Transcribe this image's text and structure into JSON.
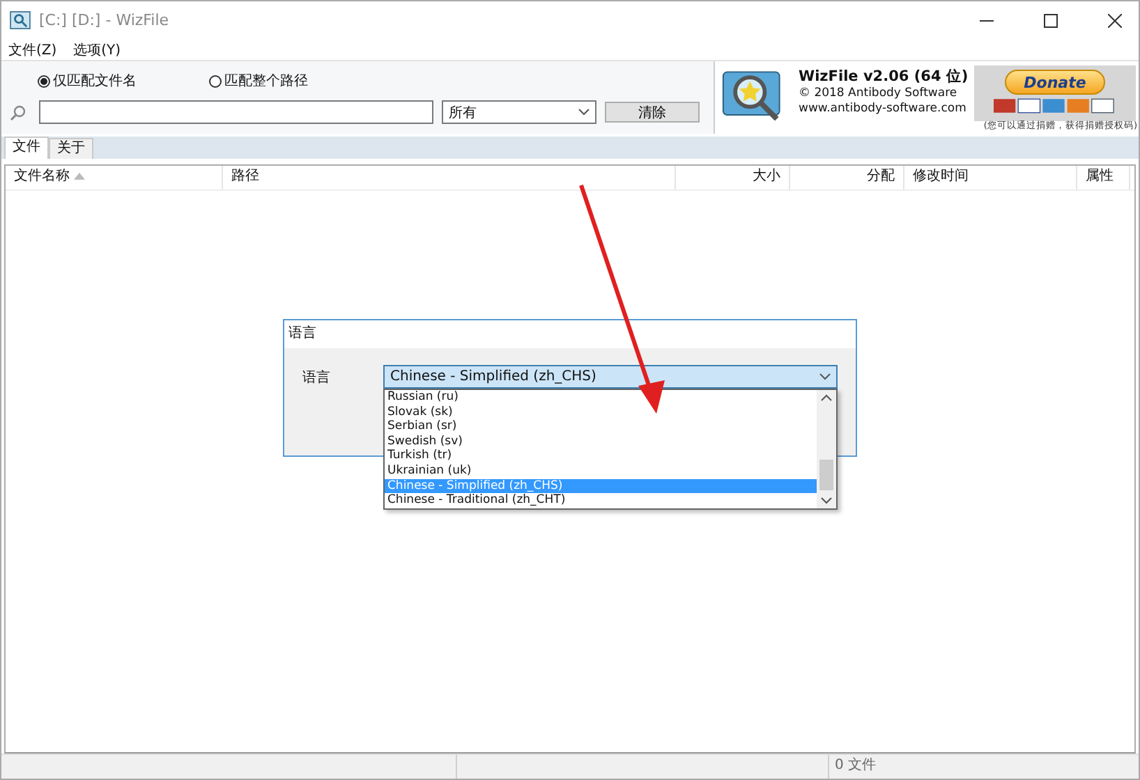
{
  "window": {
    "title": "[C:]  [D:]  - WizFile"
  },
  "menu": [
    "文件(Z)",
    "选项(Y)"
  ],
  "match_options": [
    {
      "label": "仅匹配文件名",
      "selected": true
    },
    {
      "label": "匹配整个路径",
      "selected": false
    }
  ],
  "search": {
    "filter": "所有",
    "clear_button": "清除"
  },
  "about": {
    "title": "WizFile v2.06 (64 位)",
    "copyright": "© 2018 Antibody Software",
    "website": "www.antibody-software.com",
    "donate_button": "Donate",
    "donate_note": "(您可以通过捐赠，获得捐赠授权码)"
  },
  "tabs": [
    {
      "label": "文件",
      "selected": true
    },
    {
      "label": "关于",
      "selected": false
    }
  ],
  "table": {
    "columns": [
      {
        "label": "文件名称",
        "sorted": true
      },
      {
        "label": "路径",
        "sorted": false
      },
      {
        "label": "大小",
        "sorted": false
      },
      {
        "label": "分配",
        "sorted": false
      },
      {
        "label": "修改时间",
        "sorted": false
      },
      {
        "label": "属性",
        "sorted": false
      }
    ]
  },
  "dialog": {
    "title": "语言",
    "label": "语言",
    "value": "Chinese - Simplified (zh_CHS)",
    "options": [
      {
        "label": "Russian (ru)",
        "selected": false
      },
      {
        "label": "Slovak (sk)",
        "selected": false
      },
      {
        "label": "Serbian (sr)",
        "selected": false
      },
      {
        "label": "Swedish (sv)",
        "selected": false
      },
      {
        "label": "Turkish (tr)",
        "selected": false
      },
      {
        "label": "Ukrainian (uk)",
        "selected": false
      },
      {
        "label": "Chinese - Simplified (zh_CHS)",
        "selected": true
      },
      {
        "label": "Chinese - Traditional (zh_CHT)",
        "selected": false
      }
    ]
  },
  "status_bar": {
    "file_count": "0 文件"
  }
}
